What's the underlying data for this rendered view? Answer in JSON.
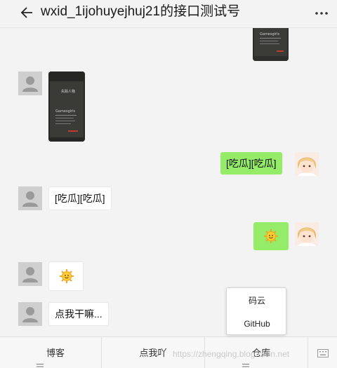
{
  "header": {
    "title": "wxid_1ijohuyejhuj21的接口测试号",
    "back_icon": "arrow-left-icon",
    "more_icon": "more-dots-icon"
  },
  "messages": [
    {
      "side": "right",
      "type": "image",
      "book_title": "Gamesgirls"
    },
    {
      "side": "left",
      "type": "image",
      "book_cn": "失踪人物",
      "book_title": "Gamesgirls"
    },
    {
      "side": "right",
      "type": "text",
      "text": "[吃瓜][吃瓜]"
    },
    {
      "side": "left",
      "type": "text",
      "text": "[吃瓜][吃瓜]"
    },
    {
      "side": "right",
      "type": "emoji",
      "emoji": "sun-emoji"
    },
    {
      "side": "left",
      "type": "emoji",
      "emoji": "sun-emoji"
    },
    {
      "side": "left",
      "type": "text",
      "text": "点我干嘛..."
    }
  ],
  "popup": {
    "items": [
      {
        "label": "码云"
      },
      {
        "label": "GitHub"
      }
    ]
  },
  "menu": {
    "items": [
      {
        "label": "博客",
        "icon": "menu-lines-icon"
      },
      {
        "label": "点我吖"
      },
      {
        "label": "仓库",
        "icon": "menu-lines-icon"
      }
    ],
    "keyboard_icon": "keyboard-icon"
  },
  "watermark": "https://zhengqing.blog.csdn.net",
  "colors": {
    "background": "#f3f3f3",
    "green_bubble": "#95ec69",
    "white_bubble": "#ffffff"
  }
}
